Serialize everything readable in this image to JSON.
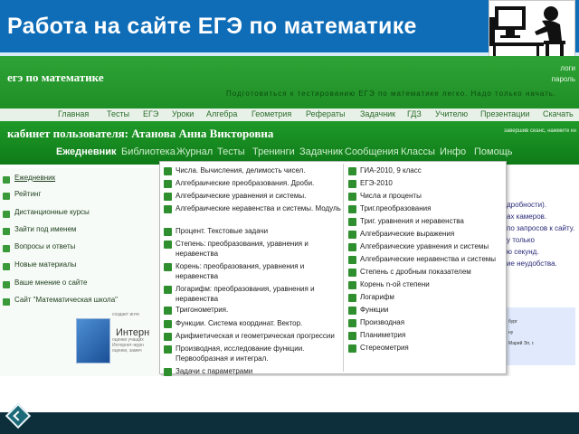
{
  "slide": {
    "title": "Работа на сайте ЕГЭ по математике",
    "image_icon": "computer-user-image"
  },
  "site": {
    "logo": "егэ по математике",
    "slogan": "Подготовиться к тестированию ЕГЭ по математике легко. Надо только начать.",
    "login_label": "логи",
    "password_label": "пароль",
    "nav": [
      "Главная",
      "Тесты",
      "ЕГЭ",
      "Уроки",
      "Алгебра",
      "Геометрия",
      "Рефераты",
      "Задачник",
      "ГДЗ",
      "Учителю",
      "Презентации",
      "Скачать"
    ]
  },
  "cabinet": {
    "title": "кабинет пользователя: Атанова Анна Викторовна",
    "note": "завершив сеанс, нажмите кн",
    "tabs": [
      "Ежедневник",
      "Библиотека",
      "Журнал",
      "Тесты",
      "Тренинги",
      "Задачник",
      "Сообщения",
      "Классы",
      "Инфо",
      "Помощь"
    ]
  },
  "sidebar": {
    "items": [
      "Ежедневник",
      "Рейтинг",
      "Дистанционные курсы",
      "Зайти под именем",
      "Вопросы и ответы",
      "Новые материалы",
      "Ваше мнение о сайте",
      "Сайт \"Математическая школа\""
    ]
  },
  "bottom_left": {
    "internet_label": "Интерн",
    "notes": [
      "создает инте",
      "оценки учащих",
      "Интернет-журн",
      "оценки, замеч"
    ]
  },
  "dropdown": {
    "left": [
      "Числа. Вычисления, делимость чисел.",
      "Алгебраические преобразования. Дроби.",
      "Алгебраические уравнения и системы.",
      "Алгебраические неравенства и системы. Модуль",
      "Процент. Текстовые задачи",
      "Степень: преобразования, уравнения и неравенства",
      "Корень: преобразования, уравнения и неравенства",
      "Логарифм: преобразования, уравнения и неравенства",
      "Тригонометрия.",
      "Функции. Система координат. Вектор.",
      "Арифметическая и геометрическая прогрессии",
      "Производная, исследование функции. Первообразная и интеграл.",
      "Задачи с параметрами",
      "Планиметрия.",
      "Стереометрия. Векторы и координаты."
    ],
    "right": [
      "ГИА-2010, 9 класс",
      "ЕГЭ-2010",
      "Числа и проценты",
      "Триг.преобразования",
      "Триг. уравнения и неравенства",
      "Алгебраические выражения",
      "Алгебраические уравнения и системы",
      "Алгебраические неравенства и системы",
      "Степень с дробным показателем",
      "Корень n-ой степени",
      "Логарифм",
      "Функции",
      "Производная",
      "Планиметрия",
      "Стереометрия"
    ]
  },
  "right_side": {
    "lines": [
      "дробности).",
      "ах камеров.",
      "по запросов к сайту.",
      "у только",
      "ю секунд.",
      "ие неудобства."
    ],
    "box_lines": [
      "бург",
      "ну",
      "Марий Эл, г."
    ]
  },
  "colors": {
    "title_bar": "#0f6db8",
    "site_green": "#1f9a29",
    "bottom_band": "#0c2f3b"
  }
}
